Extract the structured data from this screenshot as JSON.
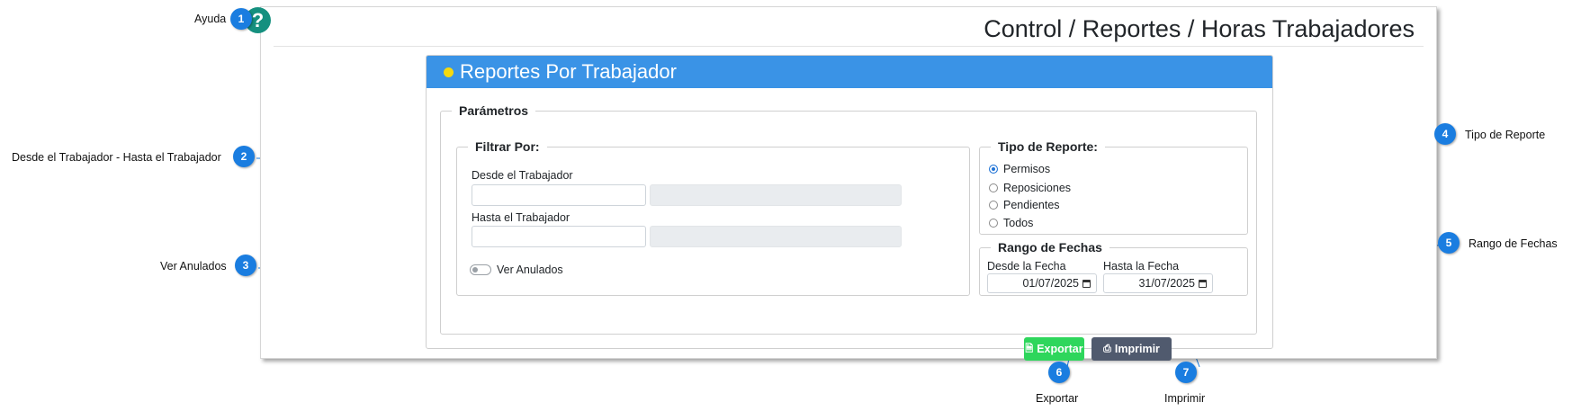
{
  "breadcrumb_title": "Control / Reportes / Horas Trabajadores",
  "card": {
    "title": "Reportes Por Trabajador"
  },
  "parametros": {
    "legend": "Parámetros",
    "filtrar": {
      "legend": "Filtrar Por:",
      "desde_label": "Desde el Trabajador",
      "hasta_label": "Hasta el Trabajador",
      "desde_value": "",
      "hasta_value": "",
      "ver_anulados_label": "Ver Anulados",
      "ver_anulados_checked": false
    },
    "tipo_reporte": {
      "legend": "Tipo de Reporte:",
      "options": [
        "Permisos",
        "Reposiciones",
        "Pendientes",
        "Todos"
      ],
      "selected": "Permisos"
    },
    "rango_fechas": {
      "legend": "Rango de Fechas",
      "desde_label": "Desde la Fecha",
      "hasta_label": "Hasta la Fecha",
      "desde_value": "01/07/2025",
      "hasta_value": "31/07/2025"
    }
  },
  "buttons": {
    "exportar": "Exportar",
    "imprimir": "Imprimir"
  },
  "help_icon": "?",
  "annotations": [
    {
      "number": "1",
      "label": "Ayuda"
    },
    {
      "number": "2",
      "label": "Desde el Trabajador - Hasta el Trabajador"
    },
    {
      "number": "3",
      "label": "Ver Anulados"
    },
    {
      "number": "4",
      "label": "Tipo de Reporte"
    },
    {
      "number": "5",
      "label": "Rango de Fechas"
    },
    {
      "number": "6",
      "label": "Exportar"
    },
    {
      "number": "7",
      "label": "Imprimir"
    }
  ],
  "colors": {
    "card_header": "#3a93e6",
    "header_dot": "#f5d90f",
    "help_icon": "#15907f",
    "export_button": "#2ed65c",
    "print_button": "#505a6e",
    "annotation_badge": "#1a7de0"
  }
}
